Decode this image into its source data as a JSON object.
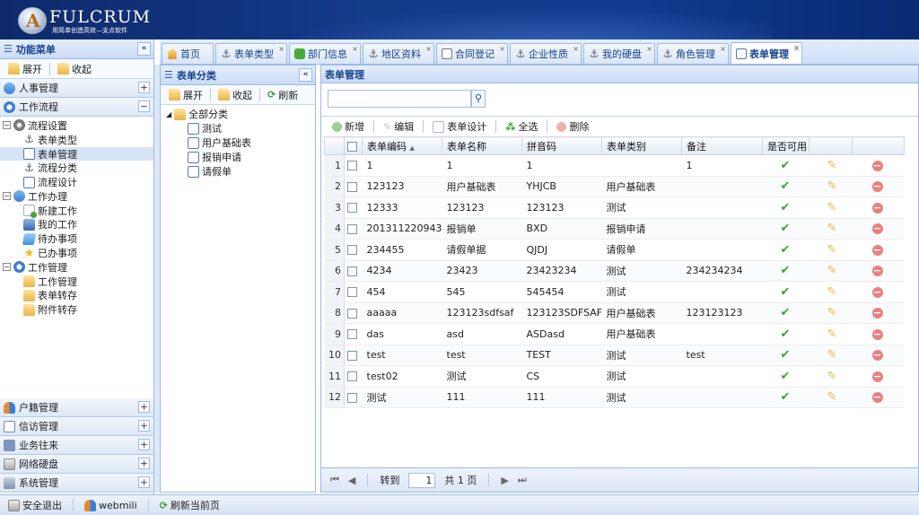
{
  "header": {
    "logo_letter": "A",
    "title": "FULCRUM",
    "subtitle": "用简单创造高效—支点软件"
  },
  "left_menu": {
    "title": "功能菜单",
    "collapse": "«",
    "expand_label": "展开",
    "collapse_label": "收起",
    "sections_top": [
      {
        "label": "人事管理",
        "toggle": "+"
      },
      {
        "label": "工作流程",
        "toggle": "−"
      }
    ],
    "tree": [
      {
        "label": "流程设置",
        "level": 0,
        "icon": "gear-icon",
        "toggle": "−"
      },
      {
        "label": "表单类型",
        "level": 1,
        "icon": "anchor-icon"
      },
      {
        "label": "表单管理",
        "level": 1,
        "icon": "form-icon",
        "selected": true
      },
      {
        "label": "流程分类",
        "level": 1,
        "icon": "anchor-icon"
      },
      {
        "label": "流程设计",
        "level": 1,
        "icon": "design-icon"
      },
      {
        "label": "工作办理",
        "level": 0,
        "icon": "process-icon",
        "toggle": "−"
      },
      {
        "label": "新建工作",
        "level": 1,
        "icon": "new-work-icon"
      },
      {
        "label": "我的工作",
        "level": 1,
        "icon": "my-work-icon"
      },
      {
        "label": "待办事项",
        "level": 1,
        "icon": "todo-icon"
      },
      {
        "label": "已办事项",
        "level": 1,
        "icon": "star-icon"
      },
      {
        "label": "工作管理",
        "level": 0,
        "icon": "power-icon",
        "toggle": "−"
      },
      {
        "label": "工作管理",
        "level": 1,
        "icon": "folder-icon"
      },
      {
        "label": "表单转存",
        "level": 1,
        "icon": "folder-icon"
      },
      {
        "label": "附件转存",
        "level": 1,
        "icon": "folder-icon"
      }
    ],
    "sections_bottom": [
      {
        "label": "户籍管理",
        "toggle": "+"
      },
      {
        "label": "信访管理",
        "toggle": "+"
      },
      {
        "label": "业务往来",
        "toggle": "+"
      },
      {
        "label": "网络硬盘",
        "toggle": "+"
      },
      {
        "label": "系统管理",
        "toggle": "+"
      }
    ]
  },
  "tabs": [
    {
      "label": "首页",
      "icon": "home-icon"
    },
    {
      "label": "表单类型",
      "icon": "anchor-icon"
    },
    {
      "label": "部门信息",
      "icon": "puzzle-icon"
    },
    {
      "label": "地区资料",
      "icon": "anchor-icon"
    },
    {
      "label": "合同登记",
      "icon": "contract-icon"
    },
    {
      "label": "企业性质",
      "icon": "anchor-icon"
    },
    {
      "label": "我的硬盘",
      "icon": "anchor-icon"
    },
    {
      "label": "角色管理",
      "icon": "anchor-icon"
    },
    {
      "label": "表单管理",
      "icon": "form-icon",
      "active": true
    }
  ],
  "tab_close": "×",
  "category_panel": {
    "title": "表单分类",
    "collapse": "«",
    "expand_label": "展开",
    "collapse_label": "收起",
    "refresh_label": "刷新",
    "root": "全部分类",
    "items": [
      "测试",
      "用户基础表",
      "报销申请",
      "请假单"
    ]
  },
  "main": {
    "title": "表单管理",
    "search_placeholder": "",
    "toolbar": {
      "add": "新增",
      "edit": "编辑",
      "design": "表单设计",
      "select_all": "全选",
      "delete": "删除"
    },
    "columns": [
      "表单编码",
      "表单名称",
      "拼音码",
      "表单类别",
      "备注",
      "是否可用"
    ],
    "sort_indicator": "▲",
    "rows": [
      {
        "n": "1",
        "code": "1",
        "name": "1",
        "py": "1",
        "cat": "",
        "note": "1"
      },
      {
        "n": "2",
        "code": "123123",
        "name": "用户基础表",
        "py": "YHJCB",
        "cat": "用户基础表",
        "note": ""
      },
      {
        "n": "3",
        "code": "12333",
        "name": "123123",
        "py": "123123",
        "cat": "测试",
        "note": ""
      },
      {
        "n": "4",
        "code": "201311220943",
        "name": "报销单",
        "py": "BXD",
        "cat": "报销申请",
        "note": ""
      },
      {
        "n": "5",
        "code": "234455",
        "name": "请假单据",
        "py": "QJDJ",
        "cat": "请假单",
        "note": ""
      },
      {
        "n": "6",
        "code": "4234",
        "name": "23423",
        "py": "23423234",
        "cat": "测试",
        "note": "234234234"
      },
      {
        "n": "7",
        "code": "454",
        "name": "545",
        "py": "545454",
        "cat": "测试",
        "note": ""
      },
      {
        "n": "8",
        "code": "aaaaa",
        "name": "123123sdfsaf",
        "py": "123123SDFSAF",
        "cat": "用户基础表",
        "note": "123123123"
      },
      {
        "n": "9",
        "code": "das",
        "name": "asd",
        "py": "ASDasd",
        "cat": "用户基础表",
        "note": ""
      },
      {
        "n": "10",
        "code": "test",
        "name": "test",
        "py": "TEST",
        "cat": "测试",
        "note": "test"
      },
      {
        "n": "11",
        "code": "test02",
        "name": "测试",
        "py": "CS",
        "cat": "测试",
        "note": ""
      },
      {
        "n": "12",
        "code": "测试",
        "name": "111",
        "py": "111",
        "cat": "测试",
        "note": ""
      }
    ],
    "enabled_symbol": "✔",
    "edit_symbol": "✎",
    "delete_symbol": "−",
    "pager": {
      "first": "⏮",
      "prev": "◀",
      "goto_label": "转到",
      "page": "1",
      "total": "共 1 页",
      "next": "▶",
      "last": "⏭"
    }
  },
  "status_bar": {
    "logout": "安全退出",
    "user": "webmili",
    "refresh": "刷新当前页"
  },
  "colors": {
    "header_bg": "#143a8a",
    "panel_border": "#99bbe8",
    "title_text": "#15428b",
    "enabled_green": "#3ea32d",
    "delete_red": "#e98080"
  }
}
